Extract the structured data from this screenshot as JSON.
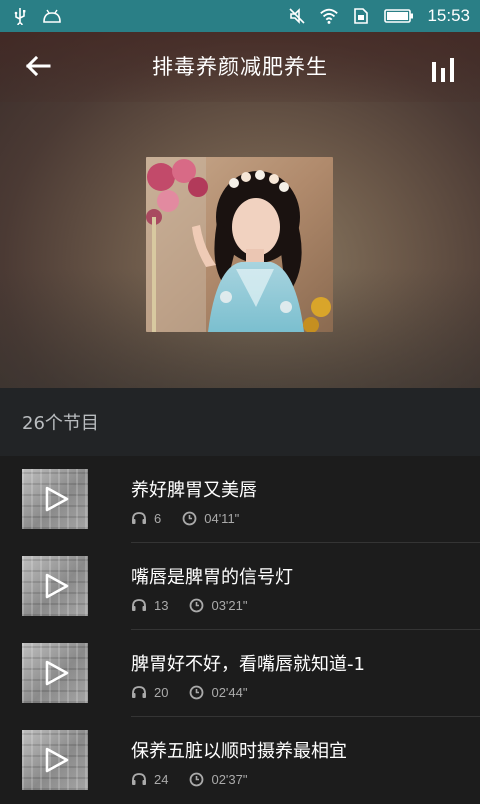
{
  "status_bar": {
    "time": "15:53",
    "icons": [
      "usb-icon",
      "android-icon",
      "mute-icon",
      "wifi-icon",
      "sim-icon",
      "battery-icon"
    ]
  },
  "header": {
    "title": "排毒养颜减肥养生",
    "back_icon": "arrow-left-icon",
    "chart_icon": "bar-chart-icon"
  },
  "section": {
    "count_label": "26个节目"
  },
  "episodes": [
    {
      "title": "养好脾胃又美唇",
      "plays": "6",
      "duration": "04'11\""
    },
    {
      "title": "嘴唇是脾胃的信号灯",
      "plays": "13",
      "duration": "03'21\""
    },
    {
      "title": "脾胃好不好，看嘴唇就知道-1",
      "plays": "20",
      "duration": "02'44\""
    },
    {
      "title": "保养五脏以顺时摄养最相宜",
      "plays": "24",
      "duration": "02'37\""
    }
  ],
  "colors": {
    "status_bar": "#2a7f86",
    "list_background": "#1c1c1c",
    "section_header": "#222426"
  }
}
